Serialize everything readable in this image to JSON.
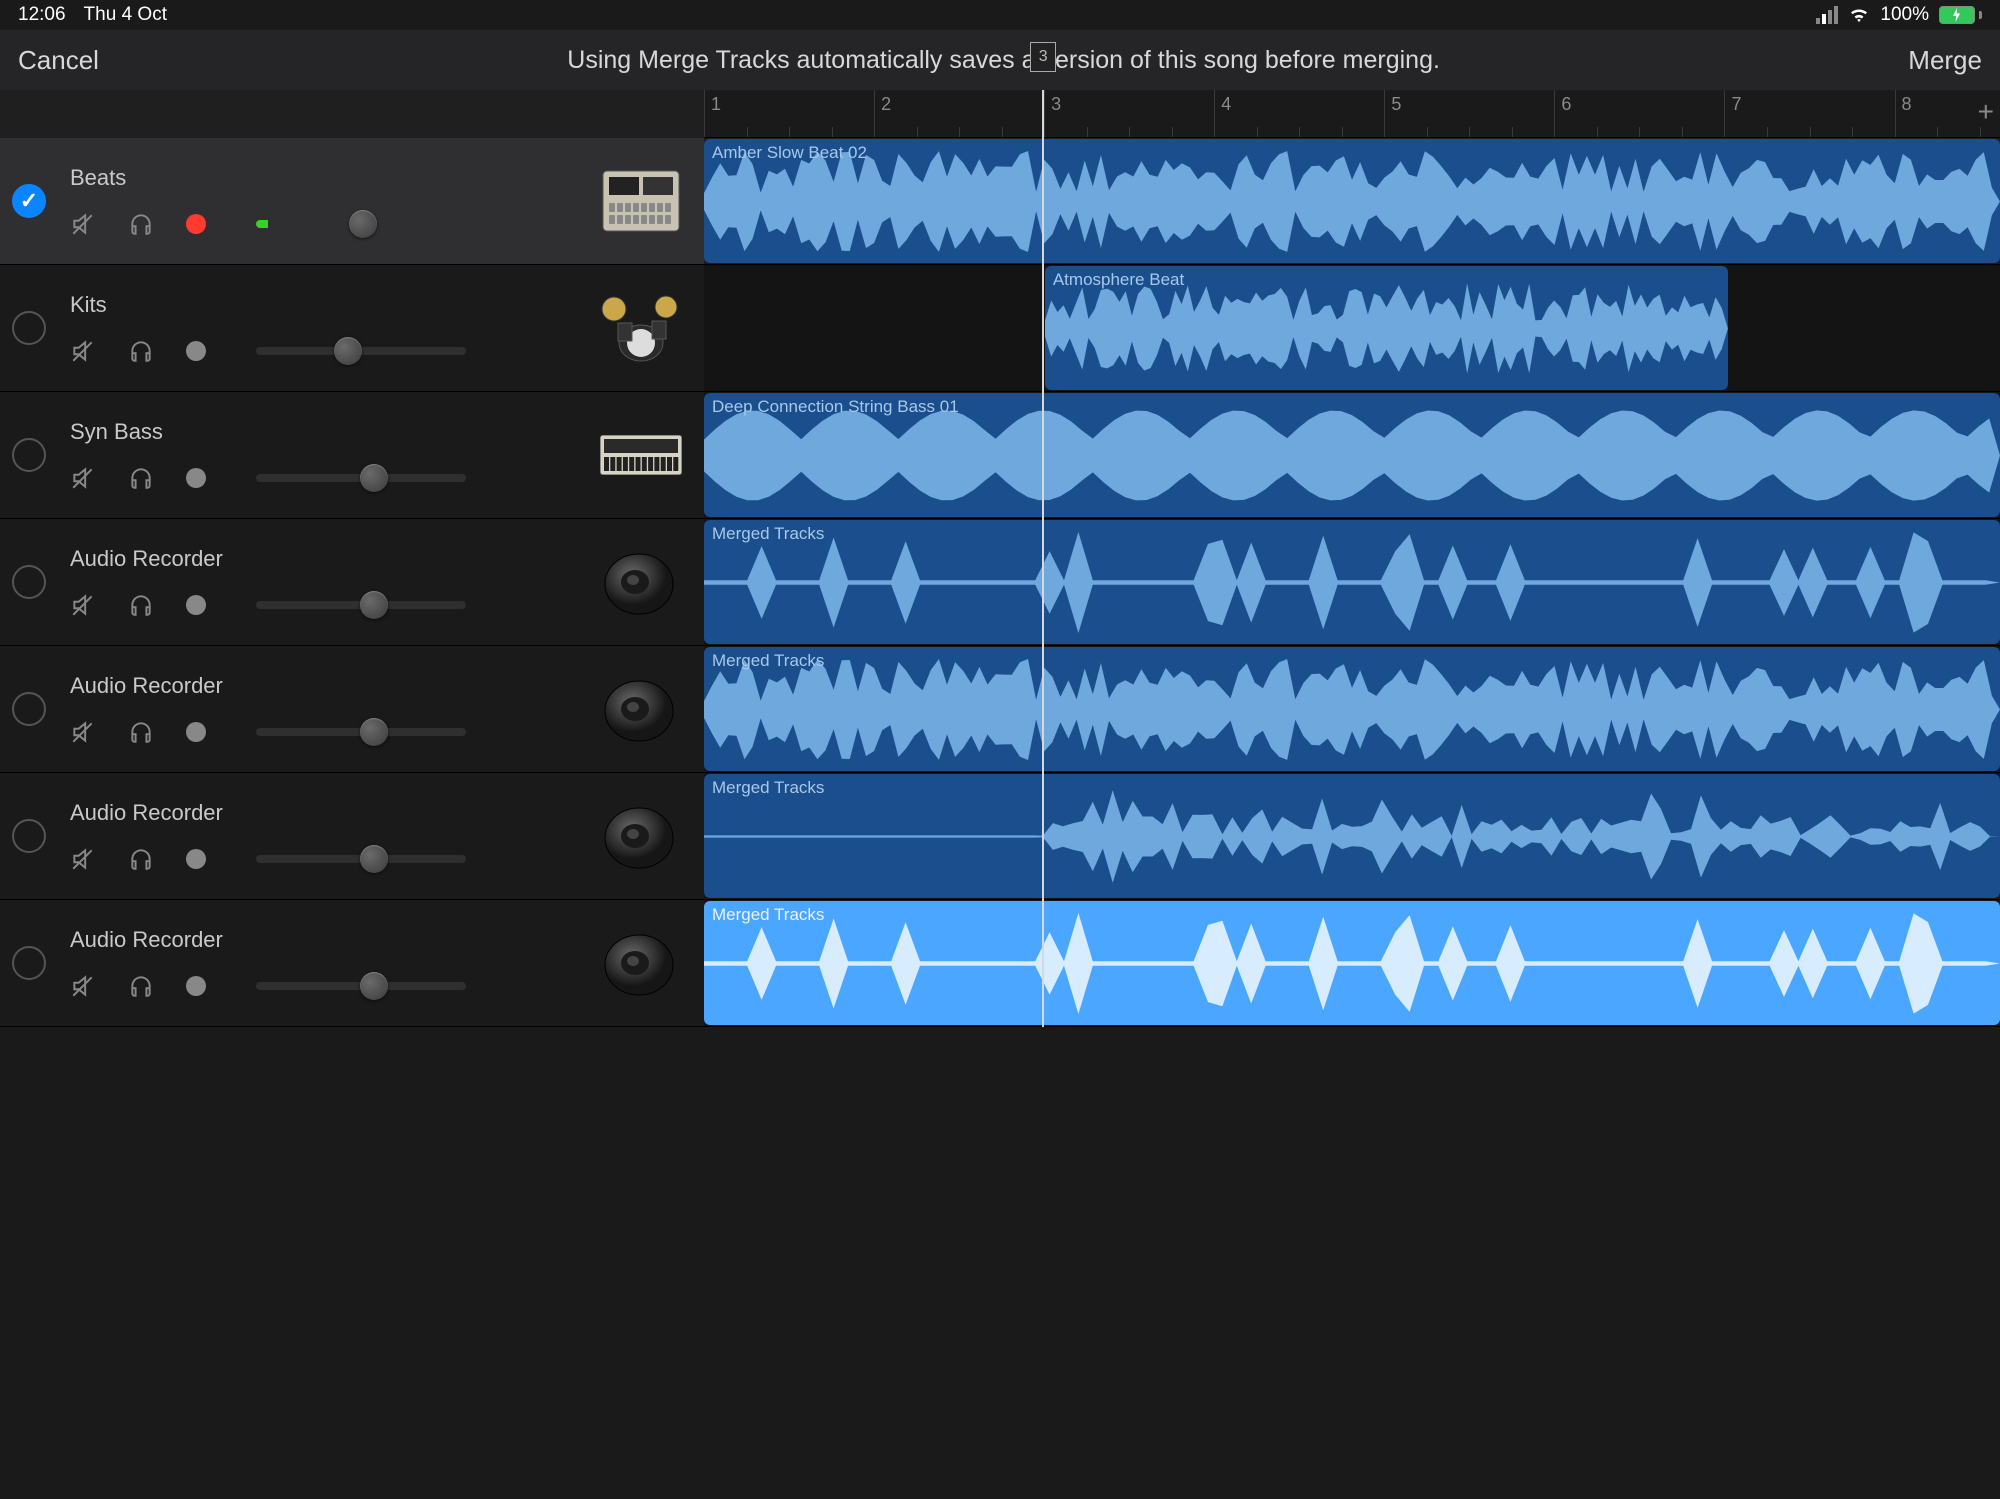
{
  "statusbar": {
    "time": "12:06",
    "date": "Thu 4 Oct",
    "battery_pct": "100%"
  },
  "navbar": {
    "cancel": "Cancel",
    "title": "Using Merge Tracks automatically saves a version of this song before merging.",
    "merge": "Merge"
  },
  "ruler": {
    "bars": [
      "1",
      "2",
      "3",
      "4",
      "5",
      "6",
      "7",
      "8"
    ],
    "playhead_label": "3"
  },
  "playhead_pos_pct": 26.1,
  "tracks": [
    {
      "name": "Beats",
      "selected": true,
      "rec": "red",
      "vol": 51,
      "led": "#38d227",
      "instrument": "drum-machine"
    },
    {
      "name": "Kits",
      "selected": false,
      "rec": "off",
      "vol": 44,
      "led": "",
      "instrument": "drum-kit"
    },
    {
      "name": "Syn Bass",
      "selected": false,
      "rec": "off",
      "vol": 56,
      "led": "",
      "instrument": "synth"
    },
    {
      "name": "Audio Recorder",
      "selected": false,
      "rec": "off",
      "vol": 56,
      "led": "",
      "instrument": "speaker"
    },
    {
      "name": "Audio Recorder",
      "selected": false,
      "rec": "off",
      "vol": 56,
      "led": "",
      "instrument": "speaker"
    },
    {
      "name": "Audio Recorder",
      "selected": false,
      "rec": "off",
      "vol": 56,
      "led": "",
      "instrument": "speaker"
    },
    {
      "name": "Audio Recorder",
      "selected": false,
      "rec": "off",
      "vol": 56,
      "led": "",
      "instrument": "speaker"
    }
  ],
  "regions": [
    {
      "lane": 0,
      "label": "Amber Slow Beat 02",
      "start_pct": 0,
      "width_pct": 100,
      "style": "blue",
      "wave": "dense"
    },
    {
      "lane": 1,
      "label": "Atmosphere Beat",
      "start_pct": 26.3,
      "width_pct": 52.7,
      "style": "blue",
      "wave": "med"
    },
    {
      "lane": 2,
      "label": "Deep Connection String Bass 01",
      "start_pct": 0,
      "width_pct": 100,
      "style": "blue",
      "wave": "bass"
    },
    {
      "lane": 3,
      "label": "Merged Tracks",
      "start_pct": 0,
      "width_pct": 100,
      "style": "blue",
      "wave": "sparse"
    },
    {
      "lane": 4,
      "label": "Merged Tracks",
      "start_pct": 0,
      "width_pct": 100,
      "style": "blue",
      "wave": "dense"
    },
    {
      "lane": 5,
      "label": "Merged Tracks",
      "start_pct": 0,
      "width_pct": 100,
      "style": "blue",
      "wave": "soft"
    },
    {
      "lane": 6,
      "label": "Merged Tracks",
      "start_pct": 0,
      "width_pct": 100,
      "style": "light",
      "wave": "sparse"
    }
  ]
}
